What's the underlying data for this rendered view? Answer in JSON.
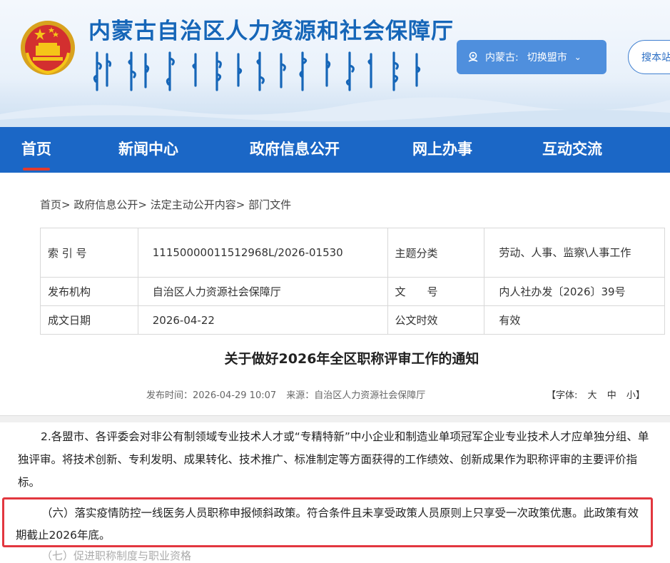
{
  "header": {
    "site_title": "内蒙古自治区人力资源和社会保障厅",
    "region_label": "内蒙古:",
    "region_switch": "切换盟市",
    "search_label": "搜本站"
  },
  "nav": {
    "items": [
      {
        "label": "首页",
        "active": true
      },
      {
        "label": "新闻中心"
      },
      {
        "label": "政府信息公开"
      },
      {
        "label": "网上办事"
      },
      {
        "label": "互动交流"
      }
    ]
  },
  "breadcrumb": {
    "items": [
      "首页",
      "政府信息公开",
      "法定主动公开内容",
      "部门文件"
    ],
    "separator": ">"
  },
  "meta": {
    "index_label": "索 引 号",
    "index_value": "11150000011512968L/2026-01530",
    "topic_label": "主题分类",
    "topic_value": "劳动、人事、监察\\人事工作",
    "org_label": "发布机构",
    "org_value": "自治区人力资源社会保障厅",
    "docno_label": "文　　号",
    "docno_value": "内人社办发〔2026〕39号",
    "date_label": "成文日期",
    "date_value": "2026-04-22",
    "validity_label": "公文时效",
    "validity_value": "有效"
  },
  "article": {
    "title": "关于做好2026年全区职称评审工作的通知",
    "publish_time": "发布时间：2026-04-29 10:07",
    "source": "来源：自治区人力资源社会保障厅",
    "font_label": "【字体:",
    "font_big": "大",
    "font_mid": "中",
    "font_small": "小】",
    "para2": "2.各盟市、各评委会对非公有制领域专业技术人才或“专精特新”中小企业和制造业单项冠军企业专业技术人才应单独分组、单独评审。将技术创新、专利发明、成果转化、技术推广、标准制定等方面获得的工作绩效、创新成果作为职称评审的主要评价指标。",
    "para6": "（六）落实疫情防控一线医务人员职称申报倾斜政策。符合条件且未享受政策人员原则上只享受一次政策优惠。此政策有效期截止2026年底。",
    "para7_cut": "（七）促进职称制度与职业资格"
  },
  "colors": {
    "brand_blue": "#1b67c6",
    "title_blue": "#1666b8",
    "active_red": "#e23b2e",
    "highlight_red": "#e2373f"
  }
}
